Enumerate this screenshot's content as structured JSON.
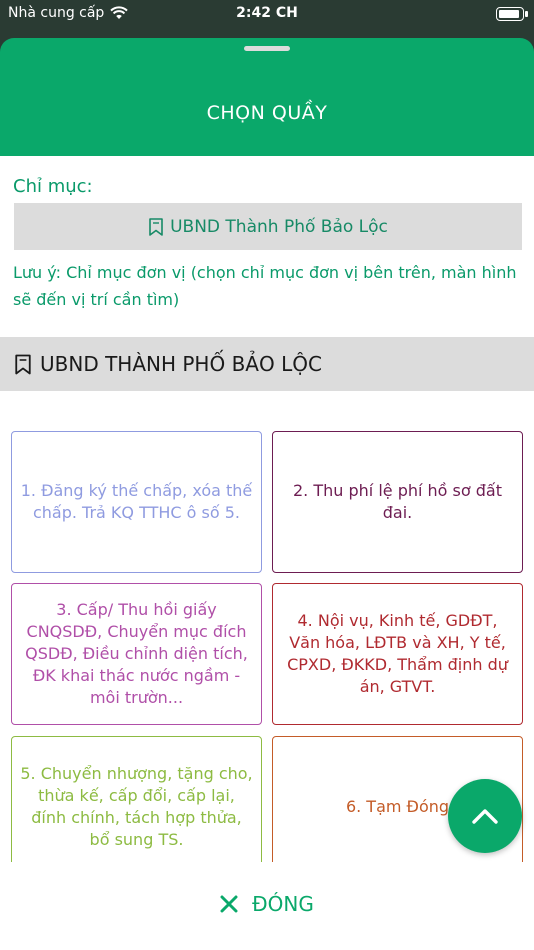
{
  "status_bar": {
    "carrier": "Nhà cung cấp",
    "time": "2:42 CH",
    "icons": [
      "wifi-icon",
      "battery-icon"
    ]
  },
  "header": {
    "title": "CHỌN QUẦY"
  },
  "index": {
    "label": "Chỉ mục:",
    "selected": "UBND Thành Phố Bảo Lộc",
    "icon": "bookmark-icon",
    "note": "Lưu ý: Chỉ mục đơn vị (chọn chỉ mục đơn vị bên trên, màn hình sẽ đến vị trí cần tìm)"
  },
  "section": {
    "title": "UBND THÀNH PHỐ BẢO LỘC",
    "icon": "bookmark-icon"
  },
  "counters": [
    {
      "label": "1. Đăng ký thế chấp, xóa thế chấp. Trả KQ TTHC ô số 5.",
      "color": "#8f9be0"
    },
    {
      "label": "2. Thu phí lệ phí hồ sơ đất đai.",
      "color": "#6d1d52"
    },
    {
      "label": "3. Cấp/ Thu hồi giấy CNQSDĐ, Chuyển mục đích QSDĐ, Điều chỉnh diện tích, ĐK khai thác nước ngầm - môi trườn...",
      "color": "#b04fa8"
    },
    {
      "label": "4. Nội vụ, Kinh tế, GDĐT, Văn hóa, LĐTB và XH, Y tế, CPXD, ĐKKD, Thẩm định dự án, GTVT.",
      "color": "#b02a30"
    },
    {
      "label": "5. Chuyển nhượng, tặng cho, thừa kế, cấp đổi, cấp lại, đính chính, tách hợp thửa, bổ sung TS.",
      "color": "#8dbb42"
    },
    {
      "label": "6. Tạm Đóng",
      "color": "#c45c28"
    }
  ],
  "fab": {
    "icon": "chevron-up-icon"
  },
  "footer": {
    "close_label": "ĐÓNG",
    "close_icon": "close-icon"
  },
  "colors": {
    "brand": "#0aa86a",
    "status_bar": "#2a3b33",
    "panel_gray": "#dcdcdc"
  }
}
